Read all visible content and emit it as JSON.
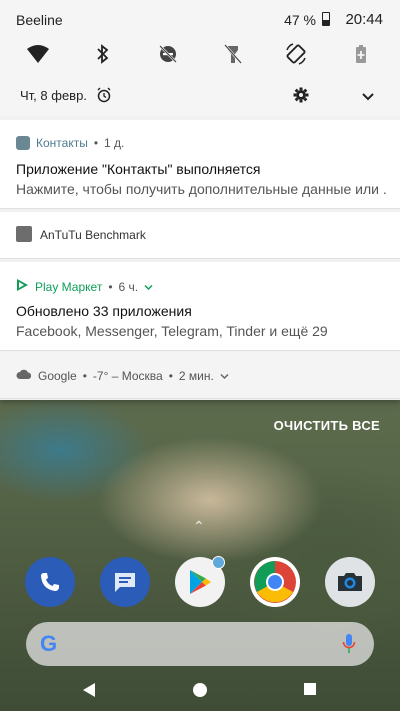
{
  "status_bar": {
    "carrier": "Beeline",
    "battery": "47 %",
    "time": "20:44"
  },
  "quick_settings": {
    "tiles": [
      "wifi-icon",
      "bluetooth-icon",
      "do-not-disturb-off-icon",
      "flashlight-off-icon",
      "auto-rotate-icon",
      "battery-saver-icon"
    ],
    "date": "Чт, 8 февр."
  },
  "notifications": [
    {
      "app": "Контакты",
      "time": "1 д.",
      "title": "Приложение \"Контакты\" выполняется",
      "body": "Нажмите, чтобы получить дополнительные данные или ..."
    },
    {
      "app": "AnTuTu Benchmark"
    },
    {
      "app": "Play Маркет",
      "time": "6 ч.",
      "title": "Обновлено 33 приложения",
      "body": "Facebook, Messenger, Telegram, Tinder и ещё 29"
    },
    {
      "app": "Google",
      "weather": "-7° – Москва",
      "time": "2 мин."
    }
  ],
  "clear_all": "ОЧИСТИТЬ ВСЕ",
  "dock": [
    "phone-icon",
    "messages-icon",
    "play-store-icon",
    "chrome-icon",
    "camera-icon"
  ],
  "search_bar": {
    "logo": "G"
  },
  "colors": {
    "accent_play": "#0f9d58",
    "contacts": "#4e7d90"
  }
}
